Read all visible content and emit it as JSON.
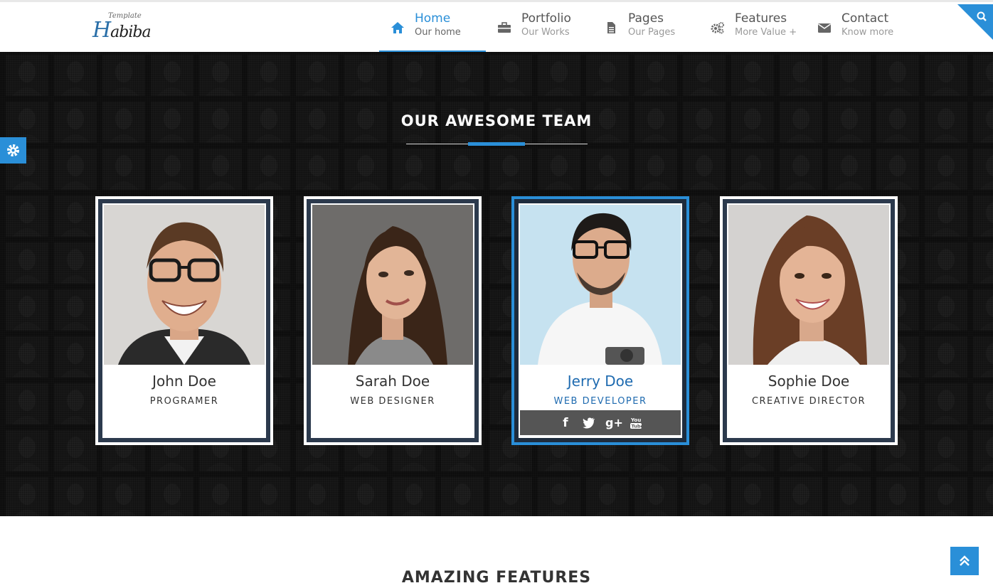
{
  "logo": {
    "small": "Template",
    "big_initial": "H",
    "big_rest": "abiba"
  },
  "nav": [
    {
      "title": "Home",
      "subtitle": "Our home",
      "icon": "home-icon",
      "active": true
    },
    {
      "title": "Portfolio",
      "subtitle": "Our Works",
      "icon": "briefcase-icon",
      "active": false
    },
    {
      "title": "Pages",
      "subtitle": "Our Pages",
      "icon": "file-icon",
      "active": false
    },
    {
      "title": "Features",
      "subtitle": "More Value +",
      "icon": "gears-icon",
      "active": false
    },
    {
      "title": "Contact",
      "subtitle": "Know more",
      "icon": "envelope-icon",
      "active": false
    }
  ],
  "team": {
    "title": "OUR AWESOME TEAM",
    "members": [
      {
        "name": "John Doe",
        "role": "PROGRAMER"
      },
      {
        "name": "Sarah Doe",
        "role": "WEB DESIGNER"
      },
      {
        "name": "Jerry Doe",
        "role": "WEB DEVELOPER",
        "socials": [
          "facebook-icon",
          "twitter-icon",
          "google-plus-icon",
          "youtube-icon"
        ]
      },
      {
        "name": "Sophie Doe",
        "role": "CREATIVE DIRECTOR"
      }
    ]
  },
  "features": {
    "title": "AMAZING FEATURES"
  },
  "colors": {
    "accent": "#2a8fd8",
    "card_frame": "#2c3a4d",
    "dark_bg": "#1e1e1e"
  }
}
